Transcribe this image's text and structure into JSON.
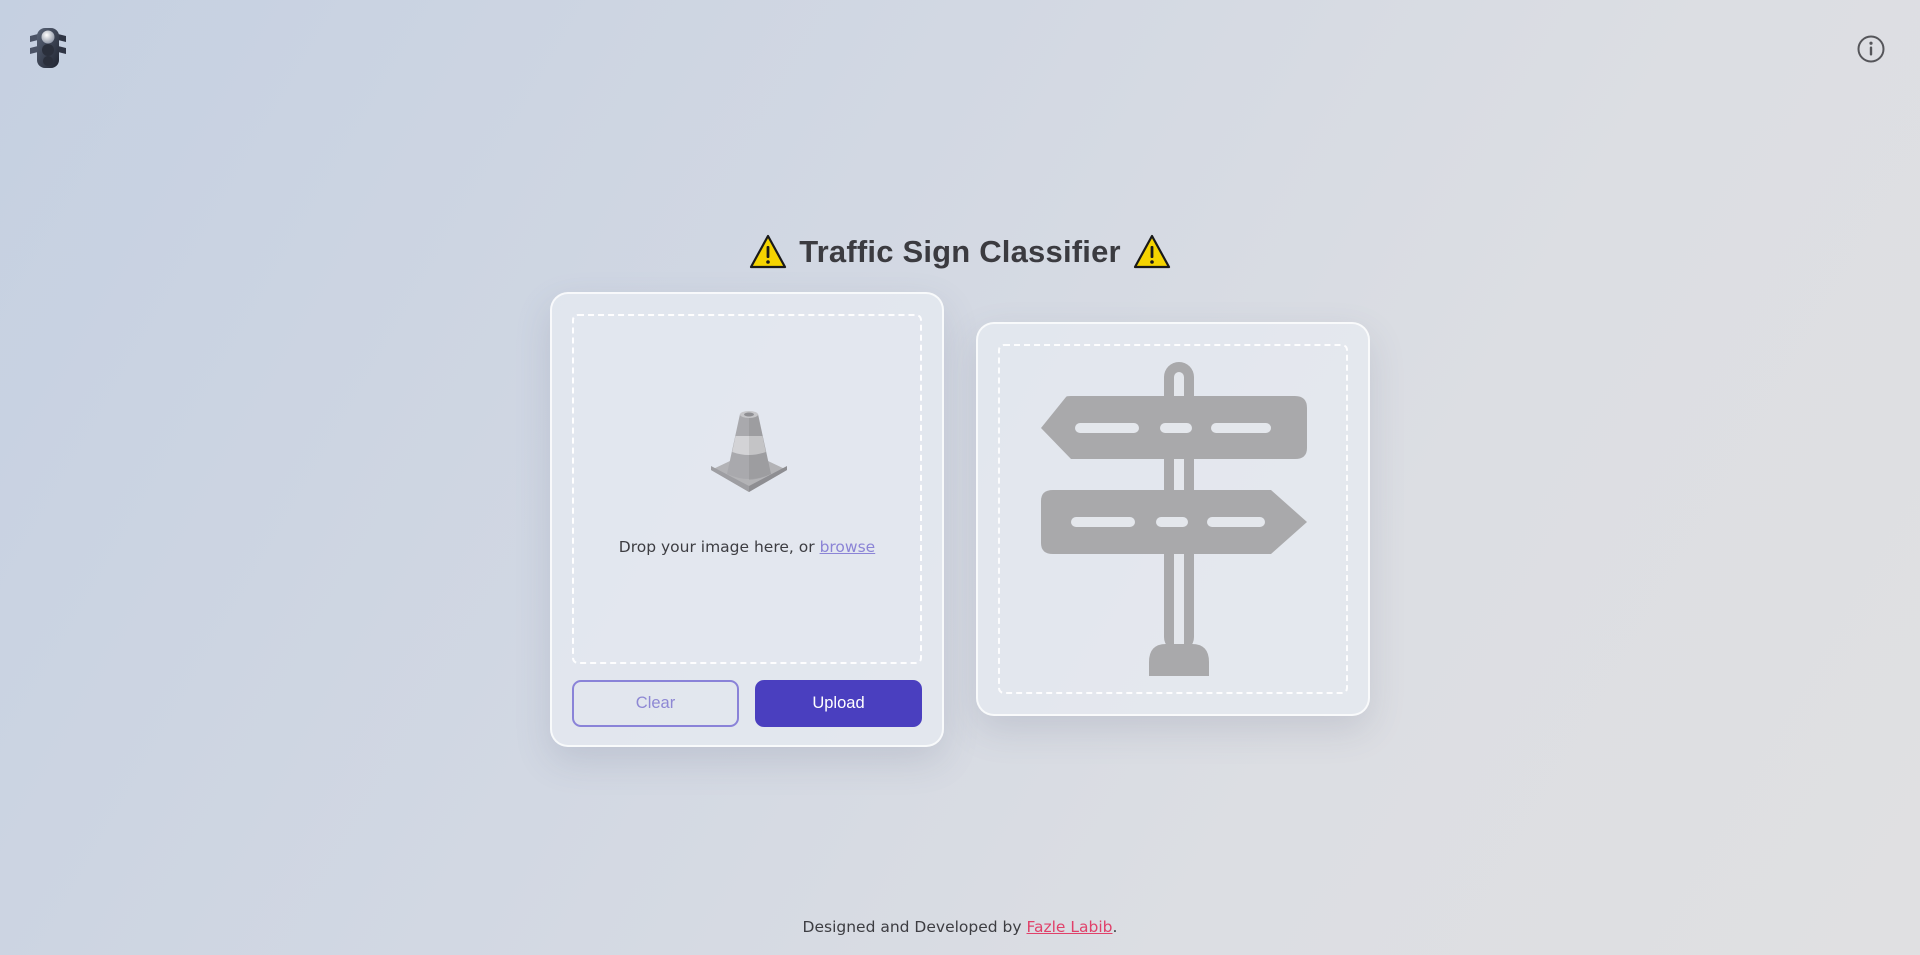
{
  "header": {
    "logo_icon": "traffic-light-icon",
    "info_icon": "info-circle-icon"
  },
  "title": {
    "text": "Traffic Sign Classifier",
    "icon": "warning-sign-icon"
  },
  "upload": {
    "illustration": "traffic-cone-icon",
    "drop_text": "Drop your image here, or ",
    "browse_label": "browse",
    "clear_label": "Clear",
    "upload_label": "Upload"
  },
  "result": {
    "illustration": "signpost-icon"
  },
  "footer": {
    "prefix": "Designed and Developed by ",
    "author": "Fazle Labib",
    "suffix": "."
  },
  "colors": {
    "accent": "#4a3fbf",
    "accent_light": "#8a83d8",
    "link_author": "#e0416a",
    "warning_yellow": "#f5d400"
  }
}
